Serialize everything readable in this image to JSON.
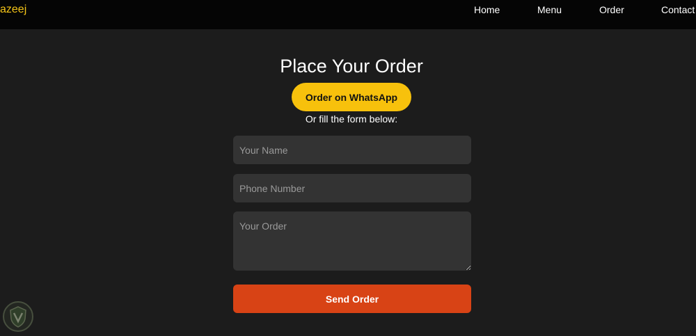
{
  "navbar": {
    "brand": "azeej",
    "links": [
      {
        "label": "Home"
      },
      {
        "label": "Menu"
      },
      {
        "label": "Order"
      },
      {
        "label": "Contact"
      }
    ]
  },
  "main": {
    "title": "Place Your Order",
    "whatsapp_button": "Order on WhatsApp",
    "subtitle": "Or fill the form below:",
    "form": {
      "name_placeholder": "Your Name",
      "phone_placeholder": "Phone Number",
      "order_placeholder": "Your Order",
      "submit_label": "Send Order"
    }
  },
  "colors": {
    "background": "#1c1c1c",
    "navbar": "#050505",
    "brand": "#f5c518",
    "whatsapp_button": "#f7c10c",
    "send_button": "#d84315",
    "field_bg": "#333333"
  },
  "icons": {
    "corner_logo": "shield-badge-icon"
  }
}
